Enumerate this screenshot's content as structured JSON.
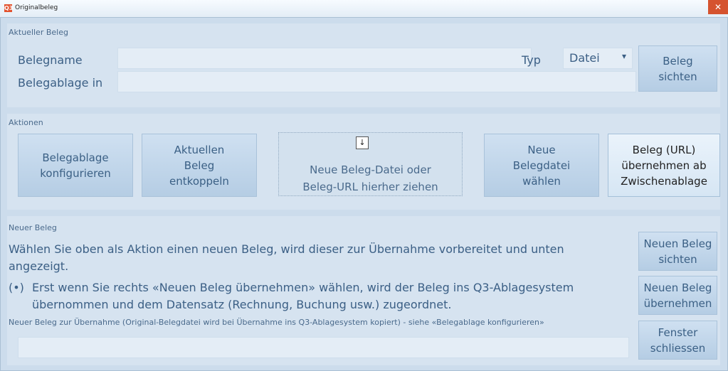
{
  "window": {
    "title": "Originalbeleg",
    "icon_glyph": "Q3",
    "close_glyph": "✕"
  },
  "aktueller": {
    "group_label": "Aktueller Beleg",
    "belegname_label": "Belegname",
    "belegname_value": "",
    "belegablage_label": "Belegablage in",
    "belegablage_value": "",
    "typ_label": "Typ",
    "typ_value": "Datei",
    "dropdown_glyph": "▾",
    "sichten_button": "Beleg\nsichten"
  },
  "aktionen": {
    "group_label": "Aktionen",
    "buttons": {
      "konfigurieren": "Belegablage\nkonfigurieren",
      "entkoppeln": "Aktuellen\nBeleg\nentkoppeln",
      "drop_zone": "Neue Beleg-Datei oder\nBeleg-URL hierher ziehen",
      "drop_icon": "↓",
      "waehlen": "Neue\nBelegdatei\nwählen",
      "zwischenablage": "Beleg (URL)\nübernehmen ab\nZwischenablage"
    }
  },
  "neuer": {
    "group_label": "Neuer Beleg",
    "line1a": "Wählen Sie oben als Aktion einen neuen Beleg, wird dieser zur Übernahme vorbereitet und unten",
    "line1b": "angezeigt.",
    "bullet": "(•)",
    "line2a": "Erst wenn Sie rechts «Neuen Beleg übernehmen» wählen, wird der Beleg ins Q3-Ablagesystem",
    "line2b": "übernommen und dem Datensatz (Rechnung, Buchung usw.) zugeordnet.",
    "field_caption": "Neuer Beleg zur Übernahme (Original-Belegdatei wird bei Übernahme ins Q3-Ablagesystem kopiert) - siehe «Belegablage konfigurieren»",
    "field_value": "",
    "btn_sichten": "Neuen Beleg\nsichten",
    "btn_uebernehmen": "Neuen Beleg\nübernehmen",
    "btn_schliessen": "Fenster\nschliessen"
  }
}
